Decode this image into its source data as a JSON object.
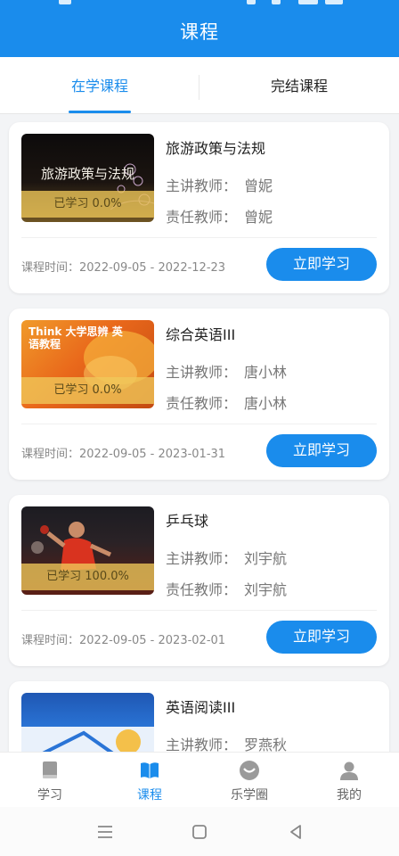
{
  "header": {
    "title": "课程"
  },
  "tabs": [
    {
      "label": "在学课程",
      "active": true
    },
    {
      "label": "完结课程",
      "active": false
    }
  ],
  "courses": [
    {
      "name": "旅游政策与法规",
      "thumb_title": "旅游政策与法规",
      "progress": "已学习 0.0%",
      "lead_label": "主讲教师：",
      "lead_teacher": "曾妮",
      "resp_label": "责任教师：",
      "resp_teacher": "曾妮",
      "period": "课程时间：2022-09-05 - 2022-12-23",
      "button": "立即学习"
    },
    {
      "name": "综合英语III",
      "thumb_title": "Think 大学思辨 英语教程",
      "progress": "已学习 0.0%",
      "lead_label": "主讲教师：",
      "lead_teacher": "唐小林",
      "resp_label": "责任教师：",
      "resp_teacher": "唐小林",
      "period": "课程时间：2022-09-05 - 2023-01-31",
      "button": "立即学习"
    },
    {
      "name": "乒乓球",
      "progress": "已学习 100.0%",
      "lead_label": "主讲教师：",
      "lead_teacher": "刘宇航",
      "resp_label": "责任教师：",
      "resp_teacher": "刘宇航",
      "period": "课程时间：2022-09-05 - 2023-02-01",
      "button": "立即学习"
    },
    {
      "name": "英语阅读III",
      "lead_label": "主讲教师：",
      "lead_teacher": "罗燕秋"
    }
  ],
  "bottom_nav": [
    {
      "label": "学习",
      "icon": "book-icon",
      "active": false
    },
    {
      "label": "课程",
      "icon": "open-book-icon",
      "active": true
    },
    {
      "label": "乐学圈",
      "icon": "community-icon",
      "active": false
    },
    {
      "label": "我的",
      "icon": "user-icon",
      "active": false
    }
  ],
  "colors": {
    "primary": "#1a8cec",
    "progress_overlay": "#f0c85a"
  }
}
